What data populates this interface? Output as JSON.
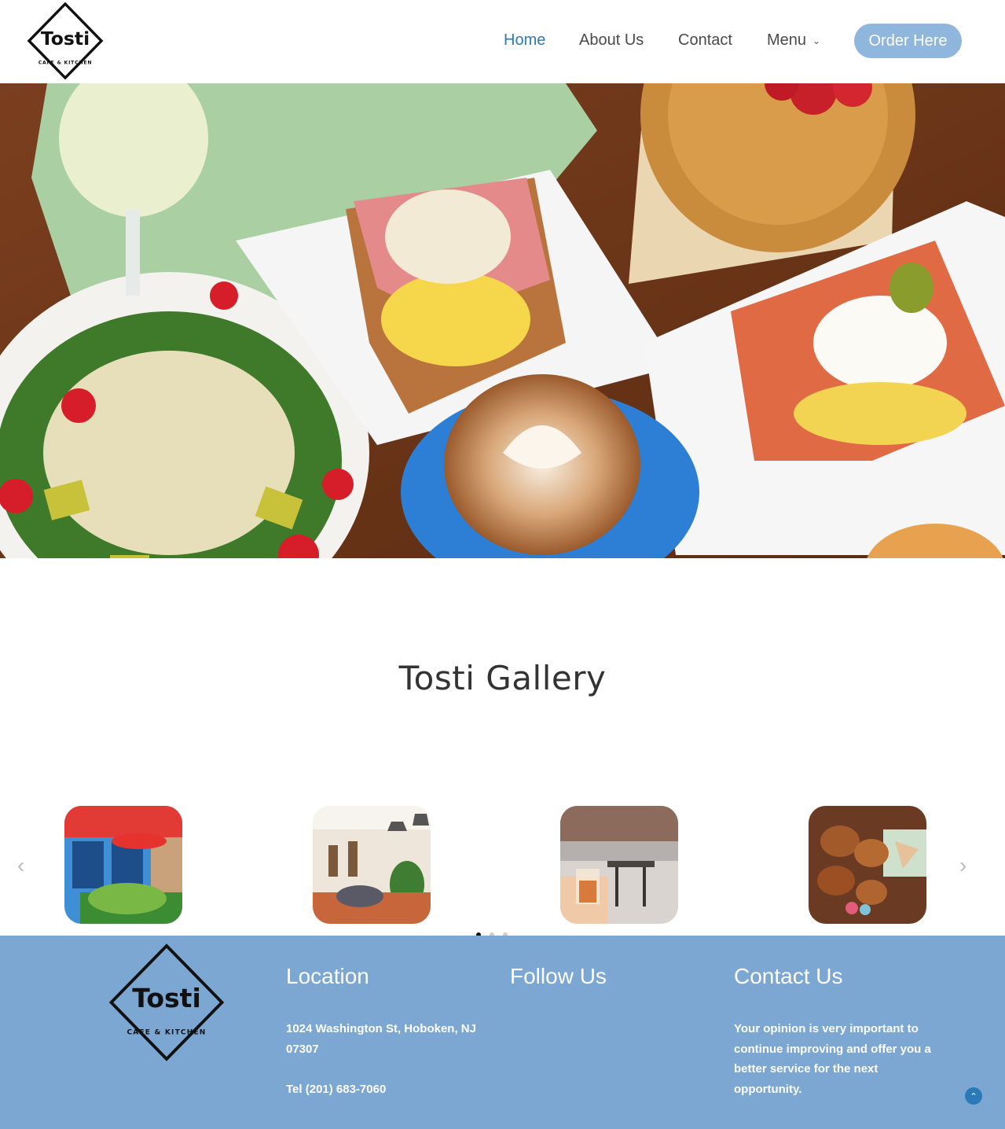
{
  "brand": {
    "name": "Tosti",
    "tagline": "CAFE & KITCHEN"
  },
  "nav": {
    "items": [
      {
        "label": "Home",
        "active": true
      },
      {
        "label": "About Us",
        "active": false
      },
      {
        "label": "Contact",
        "active": false
      },
      {
        "label": "Menu",
        "active": false
      }
    ],
    "order_label": "Order Here"
  },
  "gallery": {
    "title": "Tosti Gallery",
    "prev_icon": "chevron-left-icon",
    "next_icon": "chevron-right-icon",
    "slides": 3,
    "active_slide": 1
  },
  "footer": {
    "location_title": "Location",
    "address": "1024 Washington St, Hoboken, NJ 07307",
    "phone": "Tel (201) 683-7060",
    "follow_title": "Follow Us",
    "contact_title": "Contact Us",
    "contact_text": "Your opinion is very important to continue improving and offer you a better service for the next opportunity."
  },
  "colors": {
    "accent": "#2a7ab8",
    "button": "#8fb6dd",
    "footer_bg": "#7ba7d2"
  }
}
